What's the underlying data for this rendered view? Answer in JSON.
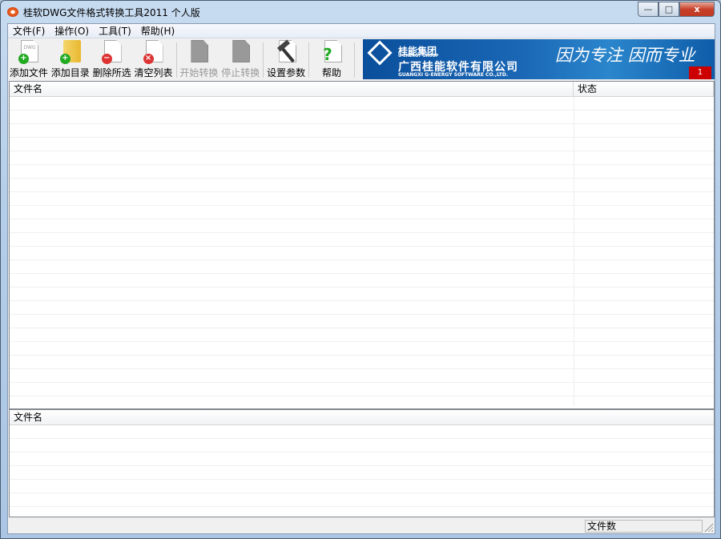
{
  "window": {
    "title": "桂软DWG文件格式转换工具2011 个人版",
    "minimize": "—",
    "maximize": "□",
    "close": "x"
  },
  "menu": [
    "文件(F)",
    "操作(O)",
    "工具(T)",
    "帮助(H)"
  ],
  "toolbar": {
    "add_file": "添加文件",
    "add_dir": "添加目录",
    "delete_selected": "删除所选",
    "clear_list": "清空列表",
    "start": "开始转换",
    "stop": "停止转换",
    "settings": "设置参数",
    "help": "帮助",
    "dwg_label": "DWG"
  },
  "banner": {
    "group": "桂能集团",
    "group_en": "G-ENERGY GROUP",
    "company": "广西桂能软件有限公司",
    "company_en": "GUANGXI G-ENERGY SOFTWARE CO.,LTD.",
    "slogan": "因为专注 因而专业",
    "badge": "1"
  },
  "file_list": {
    "columns": [
      "文件名",
      "状态"
    ],
    "rows": []
  },
  "output_list": {
    "columns": [
      "文件名"
    ],
    "rows": []
  },
  "status": {
    "file_count_label": "文件数"
  }
}
